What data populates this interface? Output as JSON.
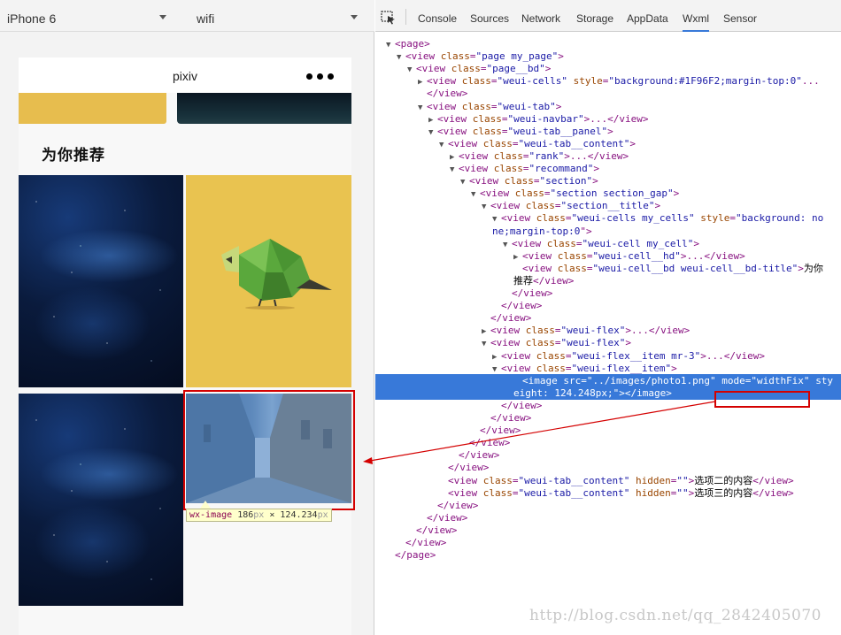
{
  "simulator": {
    "device": "iPhone 6",
    "network": "wifi",
    "nav_title": "pixiv",
    "section_title": "为你推荐",
    "tooltip": {
      "tag": "wx-image",
      "width": "186",
      "height": "124.234",
      "unit": "px",
      "times": "×"
    }
  },
  "devtools": {
    "tabs": [
      "Console",
      "Sources",
      "Network",
      "Storage",
      "AppData",
      "Wxml",
      "Sensor"
    ],
    "active_tab": "Wxml",
    "lines": [
      {
        "indent": 0,
        "tw": "▼",
        "html": "<span class='tag'>&lt;page&gt;</span>"
      },
      {
        "indent": 1,
        "tw": "▼",
        "tag": "view",
        "attrs": [
          [
            "class",
            "page my_page"
          ]
        ],
        "end": "&gt;"
      },
      {
        "indent": 2,
        "tw": "▼",
        "tag": "view",
        "attrs": [
          [
            "class",
            "page__bd"
          ]
        ],
        "end": "&gt;"
      },
      {
        "indent": 3,
        "tw": "▶",
        "tag": "view",
        "attrs": [
          [
            "class",
            "weui-cells"
          ],
          [
            "style",
            "background:#1F96F2;margin-top:0"
          ]
        ],
        "end": "..."
      },
      {
        "indent": 3,
        "tw": "",
        "html": "<span class='tag'>&lt;/view&gt;</span>"
      },
      {
        "indent": 3,
        "tw": "▼",
        "tag": "view",
        "attrs": [
          [
            "class",
            "weui-tab"
          ]
        ],
        "end": "&gt;"
      },
      {
        "indent": 4,
        "tw": "▶",
        "tag": "view",
        "attrs": [
          [
            "class",
            "weui-navbar"
          ]
        ],
        "end": "&gt;...&lt;/view&gt;"
      },
      {
        "indent": 4,
        "tw": "▼",
        "tag": "view",
        "attrs": [
          [
            "class",
            "weui-tab__panel"
          ]
        ],
        "end": "&gt;"
      },
      {
        "indent": 5,
        "tw": "▼",
        "tag": "view",
        "attrs": [
          [
            "class",
            "weui-tab__content"
          ]
        ],
        "end": "&gt;"
      },
      {
        "indent": 6,
        "tw": "▶",
        "tag": "view",
        "attrs": [
          [
            "class",
            "rank"
          ]
        ],
        "end": "&gt;...&lt;/view&gt;"
      },
      {
        "indent": 6,
        "tw": "▼",
        "tag": "view",
        "attrs": [
          [
            "class",
            "recommand"
          ]
        ],
        "end": "&gt;"
      },
      {
        "indent": 7,
        "tw": "▼",
        "tag": "view",
        "attrs": [
          [
            "class",
            "section"
          ]
        ],
        "end": "&gt;"
      },
      {
        "indent": 8,
        "tw": "▼",
        "tag": "view",
        "attrs": [
          [
            "class",
            "section section_gap"
          ]
        ],
        "end": "&gt;"
      },
      {
        "indent": 9,
        "tw": "▼",
        "tag": "view",
        "attrs": [
          [
            "class",
            "section__title"
          ]
        ],
        "end": "&gt;"
      },
      {
        "indent": 10,
        "tw": "▼",
        "tag": "view",
        "attrs": [
          [
            "class",
            "weui-cells my_cells"
          ],
          [
            "style",
            "background: no"
          ]
        ],
        "end": ""
      },
      {
        "indent": 10,
        "tw": "",
        "wrap": true,
        "html": "<span class='av'>ne;margin-top:0</span><span class='tag'>\"&gt;</span>"
      },
      {
        "indent": 11,
        "tw": "▼",
        "tag": "view",
        "attrs": [
          [
            "class",
            "weui-cell my_cell"
          ]
        ],
        "end": "&gt;"
      },
      {
        "indent": 12,
        "tw": "▶",
        "tag": "view",
        "attrs": [
          [
            "class",
            "weui-cell__hd"
          ]
        ],
        "end": "&gt;...&lt;/view&gt;"
      },
      {
        "indent": 12,
        "tw": "",
        "tag": "view",
        "attrs": [
          [
            "class",
            "weui-cell__bd weui-cell__bd-title"
          ]
        ],
        "end": "&gt;",
        "text": "为你"
      },
      {
        "indent": 12,
        "tw": "",
        "wrap": true,
        "html": "<span class='tx'>推荐</span><span class='tag'>&lt;/view&gt;</span>"
      },
      {
        "indent": 11,
        "tw": "",
        "html": "<span class='tag'>&lt;/view&gt;</span>"
      },
      {
        "indent": 10,
        "tw": "",
        "html": "<span class='tag'>&lt;/view&gt;</span>"
      },
      {
        "indent": 9,
        "tw": "",
        "html": "<span class='tag'>&lt;/view&gt;</span>"
      },
      {
        "indent": 9,
        "tw": "▶",
        "tag": "view",
        "attrs": [
          [
            "class",
            "weui-flex"
          ]
        ],
        "end": "&gt;...&lt;/view&gt;"
      },
      {
        "indent": 9,
        "tw": "▼",
        "tag": "view",
        "attrs": [
          [
            "class",
            "weui-flex"
          ]
        ],
        "end": "&gt;"
      },
      {
        "indent": 10,
        "tw": "▶",
        "tag": "view",
        "attrs": [
          [
            "class",
            "weui-flex__item mr-3"
          ]
        ],
        "end": "&gt;...&lt;/view&gt;"
      },
      {
        "indent": 10,
        "tw": "▼",
        "tag": "view",
        "attrs": [
          [
            "class",
            "weui-flex__item"
          ]
        ],
        "end": "&gt;"
      },
      {
        "indent": 12,
        "tw": "",
        "selected": true,
        "html": "<span class='tag'>&lt;image</span> <span class='an'>src</span>=<span class='av'>\"../images/photo1.png\"</span>  <span class='an'>mode</span>=<span class='av'>\"widthFix\"</span>  <span class='an'>sty</span>"
      },
      {
        "indent": 11,
        "tw": "",
        "selected": true,
        "wrap": true,
        "html": "<span class='av'>eight: 124.248px;</span><span class='tag'>\"&gt;&lt;/image&gt;</span>"
      },
      {
        "indent": 10,
        "tw": "",
        "html": "<span class='tag'>&lt;/view&gt;</span>"
      },
      {
        "indent": 9,
        "tw": "",
        "html": "<span class='tag'>&lt;/view&gt;</span>"
      },
      {
        "indent": 8,
        "tw": "",
        "html": "<span class='tag'>&lt;/view&gt;</span>"
      },
      {
        "indent": 7,
        "tw": "",
        "html": "<span class='tag'>&lt;/view&gt;</span>"
      },
      {
        "indent": 6,
        "tw": "",
        "html": "<span class='tag'>&lt;/view&gt;</span>"
      },
      {
        "indent": 5,
        "tw": "",
        "html": "<span class='tag'>&lt;/view&gt;</span>"
      },
      {
        "indent": 5,
        "tw": "",
        "tag": "view",
        "attrs": [
          [
            "class",
            "weui-tab__content"
          ],
          [
            "hidden",
            ""
          ]
        ],
        "end": "&gt;",
        "text": "选项二的内容",
        "close": "&lt;/view&gt;"
      },
      {
        "indent": 5,
        "tw": "",
        "tag": "view",
        "attrs": [
          [
            "class",
            "weui-tab__content"
          ],
          [
            "hidden",
            ""
          ]
        ],
        "end": "&gt;",
        "text": "选项三的内容",
        "close": "&lt;/view&gt;"
      },
      {
        "indent": 4,
        "tw": "",
        "html": "<span class='tag'>&lt;/view&gt;</span>"
      },
      {
        "indent": 3,
        "tw": "",
        "html": "<span class='tag'>&lt;/view&gt;</span>"
      },
      {
        "indent": 2,
        "tw": "",
        "html": "<span class='tag'>&lt;/view&gt;</span>"
      },
      {
        "indent": 1,
        "tw": "",
        "html": "<span class='tag'>&lt;/view&gt;</span>"
      },
      {
        "indent": 0,
        "tw": "",
        "html": "<span class='tag'>&lt;/page&gt;</span>"
      }
    ]
  },
  "watermark": "http://blog.csdn.net/qq_2842405070",
  "colors": {
    "accent": "#3879d9",
    "highlight": "#d40000",
    "tag": "#881280",
    "attr_name": "#994500",
    "attr_value": "#1a1aa6"
  }
}
